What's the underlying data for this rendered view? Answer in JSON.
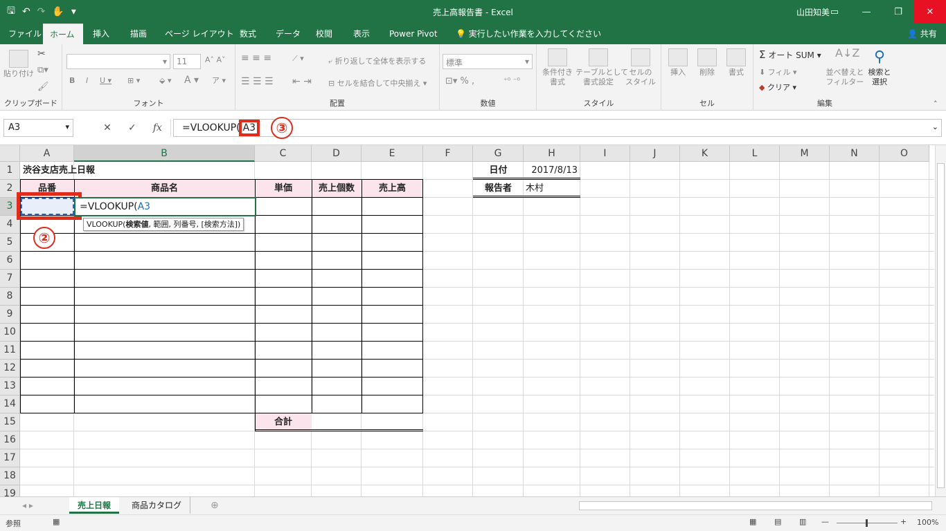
{
  "window": {
    "title": "売上高報告書 - Excel",
    "user": "山田知美",
    "share": "共有"
  },
  "tabs": [
    "ファイル",
    "ホーム",
    "挿入",
    "描画",
    "ページ レイアウト",
    "数式",
    "データ",
    "校閲",
    "表示",
    "Power Pivot"
  ],
  "tell_me": "実行したい作業を入力してください",
  "ribbon": {
    "clipboard": {
      "paste": "貼り付け",
      "label": "クリップボード"
    },
    "font": {
      "label": "フォント",
      "size": "11"
    },
    "alignment": {
      "wrap": "折り返して全体を表示する",
      "merge": "セルを結合して中央揃え",
      "label": "配置"
    },
    "number": {
      "format": "標準",
      "label": "数値"
    },
    "styles": {
      "conditional": "条件付き\n書式",
      "table": "テーブルとして\n書式設定",
      "cell": "セルの\nスタイル",
      "label": "スタイル"
    },
    "cells": {
      "insert": "挿入",
      "delete": "削除",
      "format": "書式",
      "label": "セル"
    },
    "editing": {
      "autosum": "オート SUM",
      "fill": "フィル",
      "clear": "クリア",
      "sort": "並べ替えと\nフィルター",
      "find": "検索と\n選択",
      "label": "編集"
    }
  },
  "formula_bar": {
    "name_box": "A3",
    "formula_prefix": "=VLOOKUP(",
    "formula_ref": "A3"
  },
  "columns": [
    "A",
    "B",
    "C",
    "D",
    "E",
    "F",
    "G",
    "H",
    "I",
    "J",
    "K",
    "L",
    "M",
    "N",
    "O"
  ],
  "rows": [
    "1",
    "2",
    "3",
    "4",
    "5",
    "6",
    "7",
    "8",
    "9",
    "10",
    "11",
    "12",
    "13",
    "14",
    "15",
    "16",
    "17",
    "18",
    "19"
  ],
  "sheet": {
    "title": "渋谷支店売上日報",
    "headers": [
      "品番",
      "商品名",
      "単価",
      "売上個数",
      "売上高"
    ],
    "total_label": "合計",
    "date_label": "日付",
    "date_value": "2017/8/13",
    "reporter_label": "報告者",
    "reporter_value": "木村",
    "edit_prefix": "=VLOOKUP(",
    "edit_ref": "A3",
    "tooltip_fn": "VLOOKUP(",
    "tooltip_bold": "検索値",
    "tooltip_rest": ", 範囲, 列番号, [検索方法])"
  },
  "annotations": {
    "two": "②",
    "three": "③"
  },
  "sheet_tabs": [
    "売上日報",
    "商品カタログ"
  ],
  "status": {
    "mode": "参照",
    "zoom": "100%"
  },
  "colors": {
    "accent": "#217346",
    "header_pink": "#fce4ec",
    "annotation_red": "#e02c1b"
  }
}
